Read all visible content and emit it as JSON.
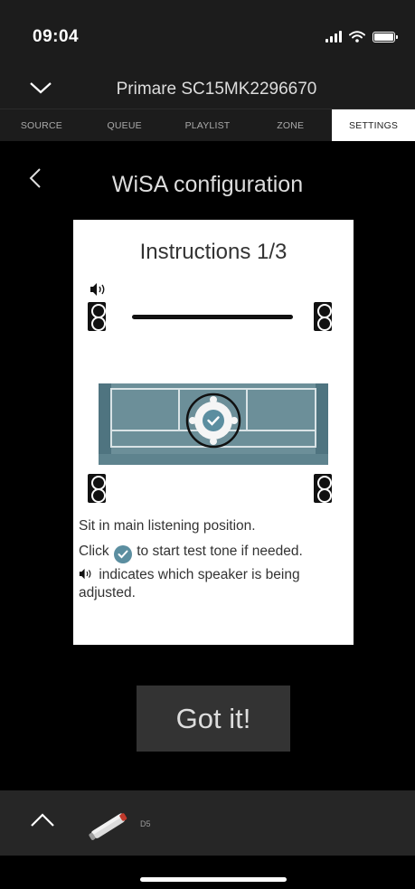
{
  "status_bar": {
    "time": "09:04"
  },
  "header": {
    "device_name": "Primare SC15MK2296670"
  },
  "tabs": [
    {
      "label": "SOURCE",
      "active": false
    },
    {
      "label": "QUEUE",
      "active": false
    },
    {
      "label": "PLAYLIST",
      "active": false
    },
    {
      "label": "ZONE",
      "active": false
    },
    {
      "label": "SETTINGS",
      "active": true
    }
  ],
  "page": {
    "title": "WiSA configuration"
  },
  "card": {
    "title": "Instructions 1/3",
    "line1": "Sit in main listening position.",
    "line2_prefix": "Click",
    "line2_suffix": "to start test tone if needed.",
    "line3_suffix": "indicates which speaker is being",
    "line4": "adjusted."
  },
  "actions": {
    "got_it": "Got it!"
  },
  "player": {
    "source_label": "D5"
  },
  "colors": {
    "accent": "#5b8ea0",
    "sofa": "#6c8f99",
    "sofa_dark": "#4f7480"
  }
}
